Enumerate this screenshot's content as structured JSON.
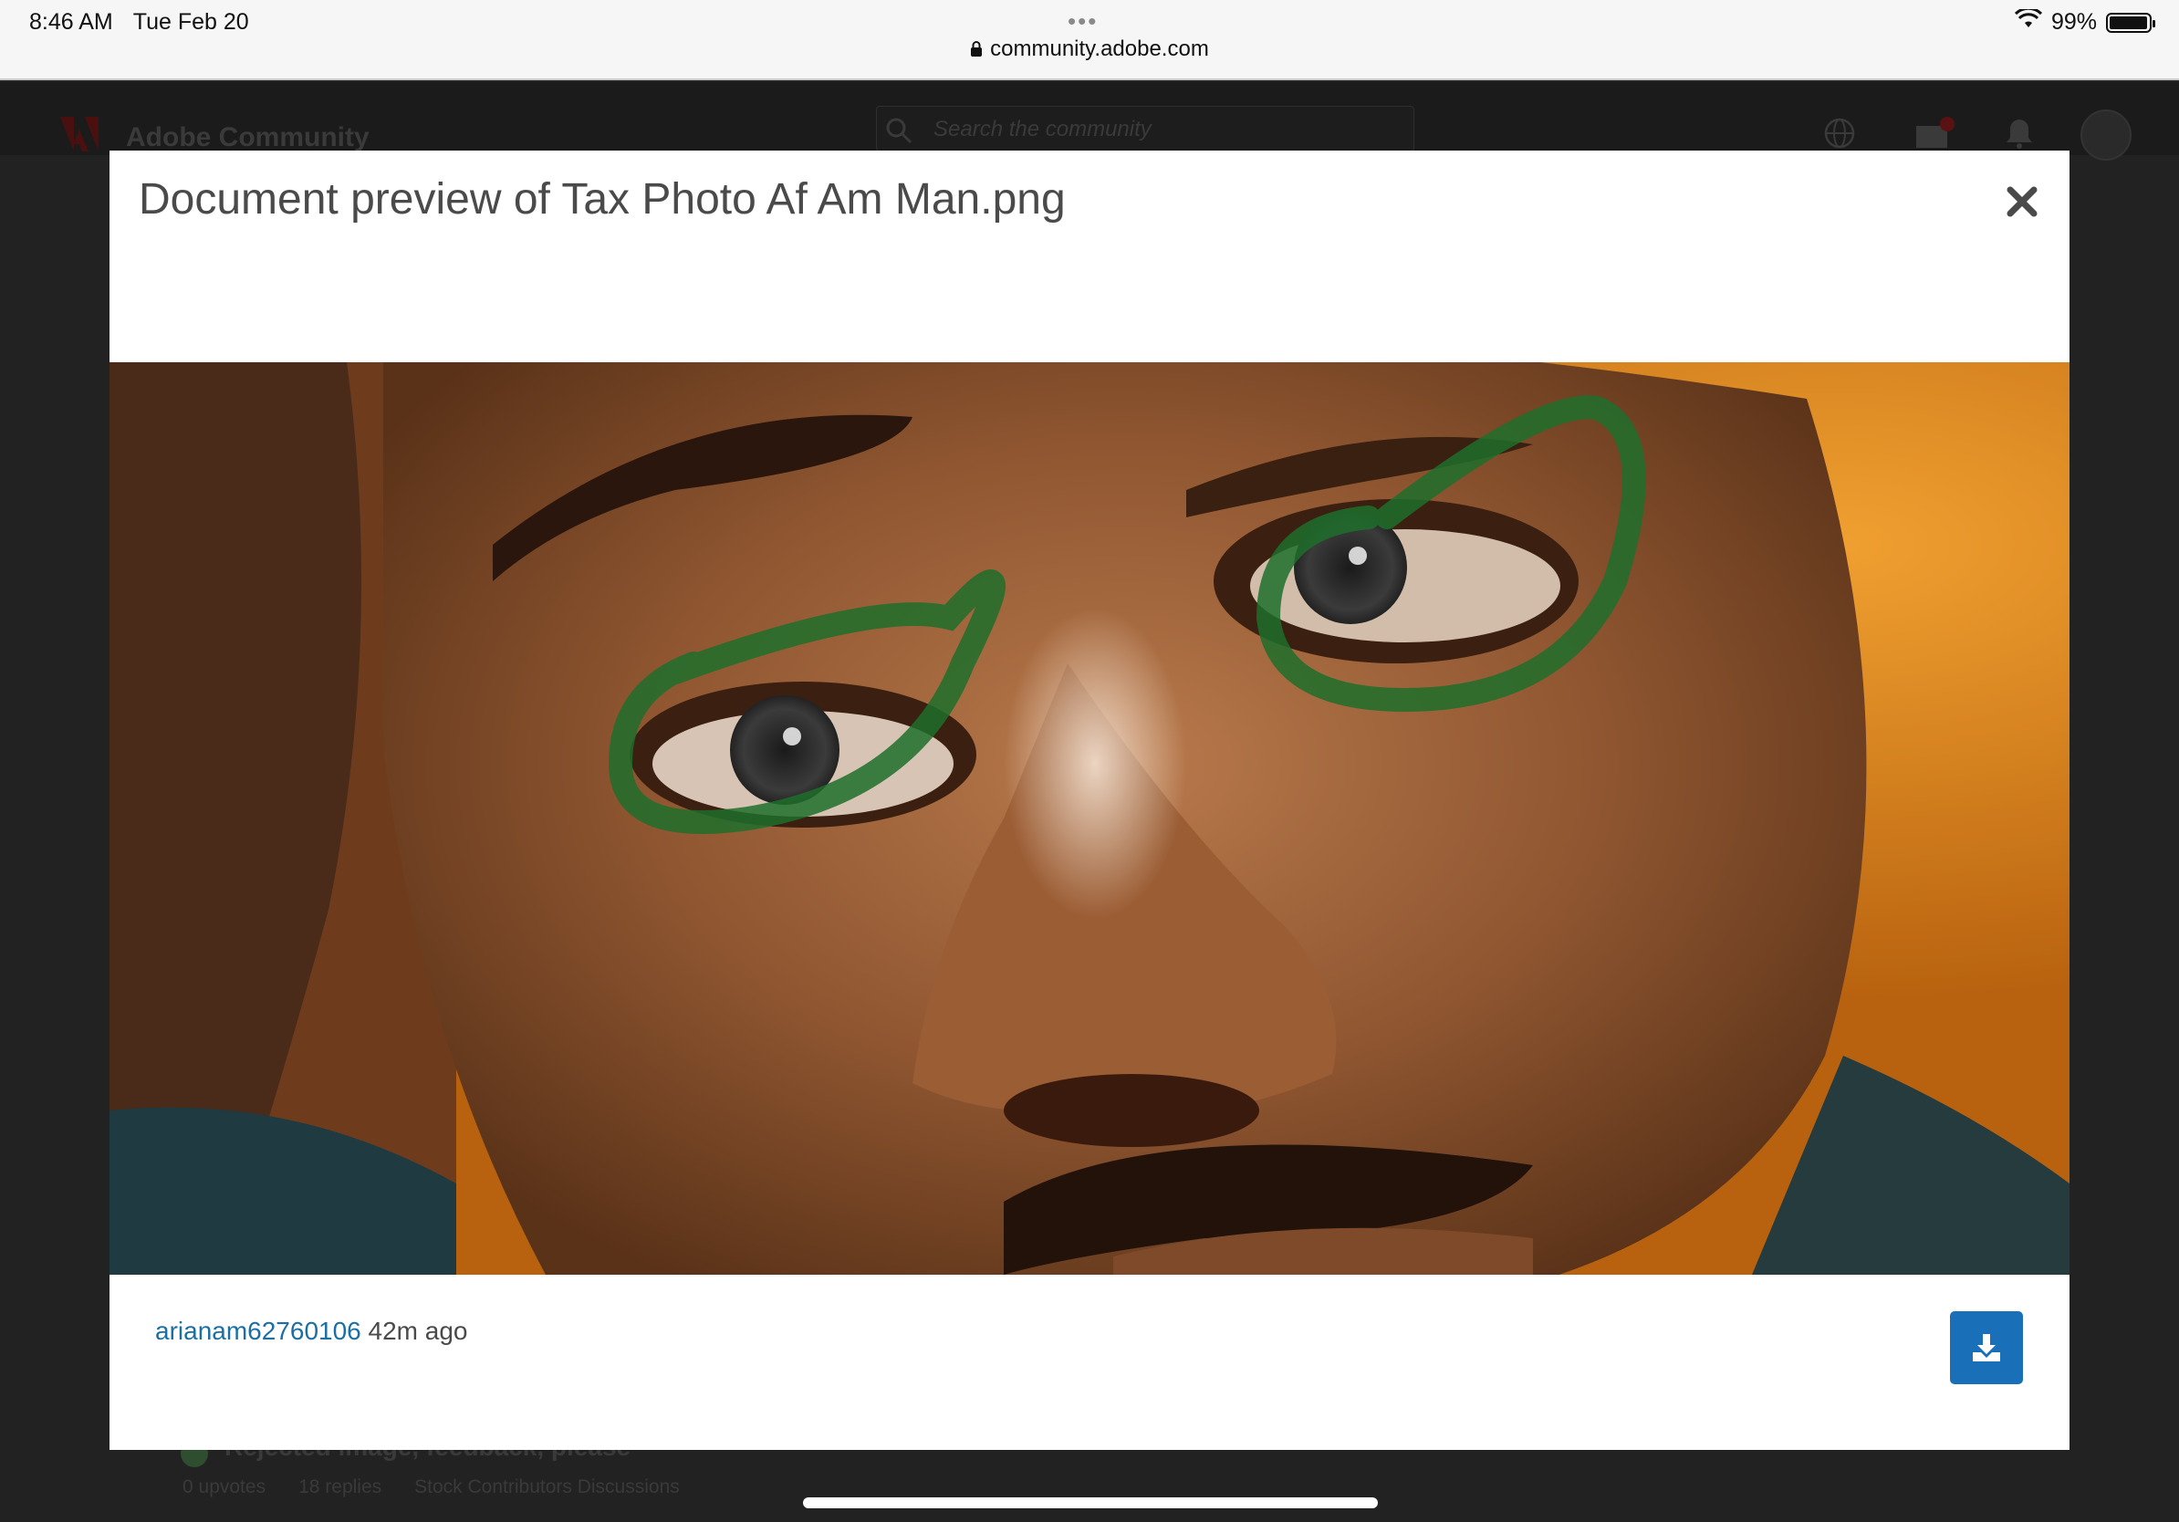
{
  "status_bar": {
    "time": "8:46 AM",
    "date": "Tue Feb 20",
    "url": "community.adobe.com",
    "battery": "99%",
    "battery_level": 0.99
  },
  "background_page": {
    "brand": "Adobe Community",
    "search_placeholder": "Search the community",
    "messages_badge": "1",
    "topic_title": "Rejected image, feedback, please",
    "topic_upvotes": "0 upvotes",
    "topic_replies": "18 replies",
    "topic_board": "Stock Contributors Discussions"
  },
  "modal": {
    "title": "Document preview of Tax Photo Af Am Man.png",
    "author": "arianam62760106",
    "time_ago": "42m ago"
  },
  "icons": {
    "close": "close-icon",
    "download": "download-icon",
    "lock": "lock-icon",
    "wifi": "wifi-icon",
    "globe": "globe-icon",
    "messages": "mail-icon",
    "notifications": "bell-icon",
    "search": "search-icon"
  },
  "colors": {
    "link": "#1a6fa5",
    "download_button": "#1a70b8",
    "annotation_green": "#1f6f2c"
  }
}
